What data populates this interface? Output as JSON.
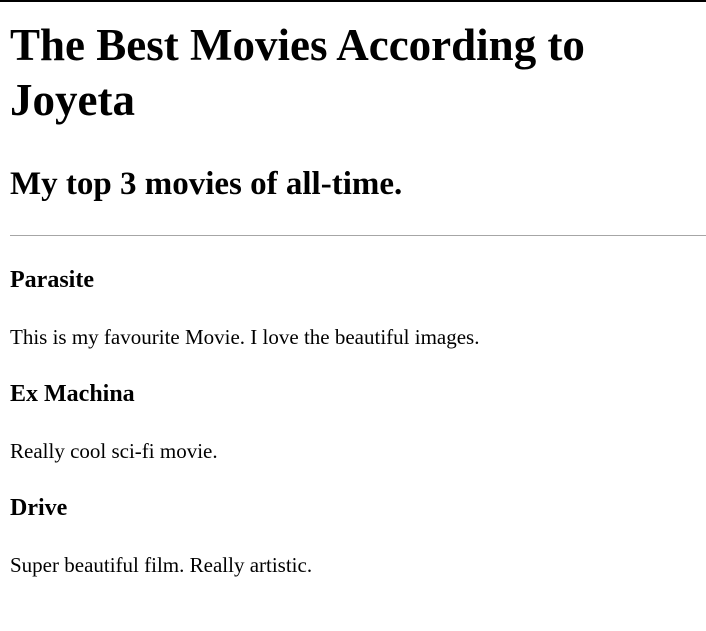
{
  "page": {
    "title": "The Best Movies According to Joyeta",
    "subtitle": "My top 3 movies of all-time."
  },
  "movies": [
    {
      "name": "Parasite",
      "description": "This is my favourite Movie. I love the beautiful images."
    },
    {
      "name": "Ex Machina",
      "description": "Really cool sci-fi movie."
    },
    {
      "name": "Drive",
      "description": "Super beautiful film. Really artistic."
    }
  ]
}
